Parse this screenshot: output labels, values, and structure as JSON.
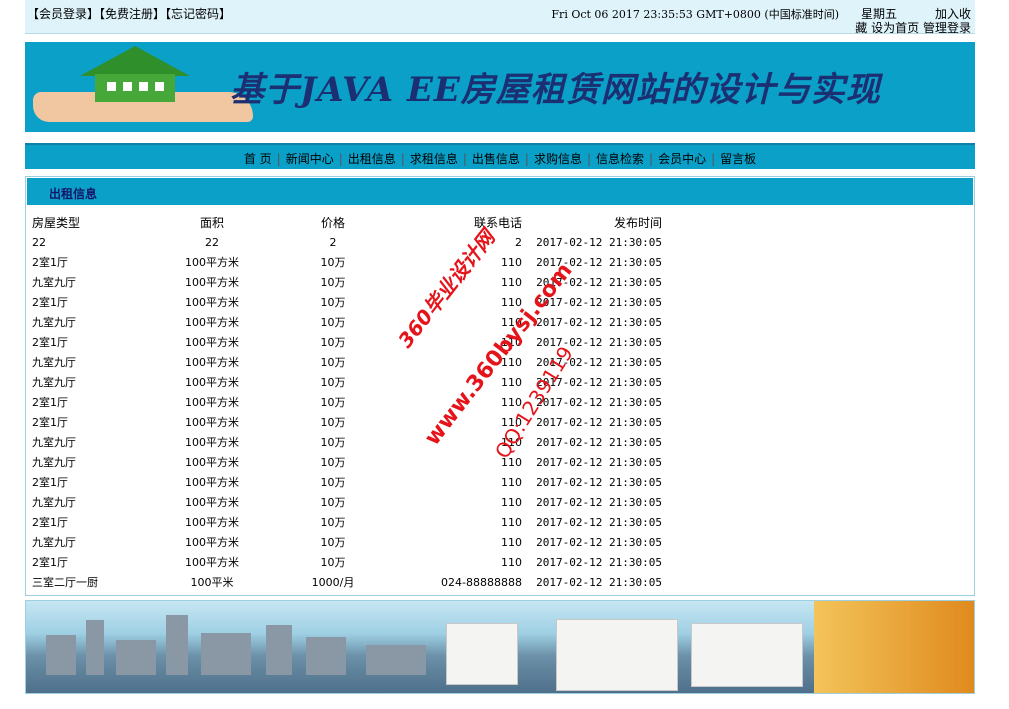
{
  "topbar": {
    "member_login": "【会员登录】",
    "register": "【免费注册】",
    "forgot_password": "【忘记密码】",
    "clock": "Fri Oct 06 2017 23:35:53 GMT+0800 (中国标准时间)",
    "weekday": "星期五",
    "add_favorite_1": "加入收",
    "add_favorite_2": "藏",
    "set_homepage": "设为首页",
    "admin_login": "管理登录"
  },
  "banner": {
    "title": "基于JAVA EE房屋租赁网站的设计与实现"
  },
  "nav": {
    "items": [
      "首 页",
      "新闻中心",
      "出租信息",
      "求租信息",
      "出售信息",
      "求购信息",
      "信息检索",
      "会员中心",
      "留言板"
    ]
  },
  "panel": {
    "title": "出租信息",
    "columns": [
      "房屋类型",
      "面积",
      "价格",
      "联系电话",
      "发布时间"
    ],
    "rows": [
      [
        "22",
        "22",
        "2",
        "2",
        "2017-02-12 21:30:05"
      ],
      [
        "2室1厅",
        "100平方米",
        "10万",
        "110",
        "2017-02-12 21:30:05"
      ],
      [
        "九室九厅",
        "100平方米",
        "10万",
        "110",
        "2017-02-12 21:30:05"
      ],
      [
        "2室1厅",
        "100平方米",
        "10万",
        "110",
        "2017-02-12 21:30:05"
      ],
      [
        "九室九厅",
        "100平方米",
        "10万",
        "110",
        "2017-02-12 21:30:05"
      ],
      [
        "2室1厅",
        "100平方米",
        "10万",
        "110",
        "2017-02-12 21:30:05"
      ],
      [
        "九室九厅",
        "100平方米",
        "10万",
        "110",
        "2017-02-12 21:30:05"
      ],
      [
        "九室九厅",
        "100平方米",
        "10万",
        "110",
        "2017-02-12 21:30:05"
      ],
      [
        "2室1厅",
        "100平方米",
        "10万",
        "110",
        "2017-02-12 21:30:05"
      ],
      [
        "2室1厅",
        "100平方米",
        "10万",
        "110",
        "2017-02-12 21:30:05"
      ],
      [
        "九室九厅",
        "100平方米",
        "10万",
        "110",
        "2017-02-12 21:30:05"
      ],
      [
        "九室九厅",
        "100平方米",
        "10万",
        "110",
        "2017-02-12 21:30:05"
      ],
      [
        "2室1厅",
        "100平方米",
        "10万",
        "110",
        "2017-02-12 21:30:05"
      ],
      [
        "九室九厅",
        "100平方米",
        "10万",
        "110",
        "2017-02-12 21:30:05"
      ],
      [
        "2室1厅",
        "100平方米",
        "10万",
        "110",
        "2017-02-12 21:30:05"
      ],
      [
        "九室九厅",
        "100平方米",
        "10万",
        "110",
        "2017-02-12 21:30:05"
      ],
      [
        "2室1厅",
        "100平方米",
        "10万",
        "110",
        "2017-02-12 21:30:05"
      ],
      [
        "三室二厅一厨",
        "100平米",
        "1000/月",
        "024-88888888",
        "2017-02-12 21:30:05"
      ]
    ]
  },
  "watermark": {
    "line1": "360毕业设计网",
    "line2": "www.360bysj.com",
    "line3": "QQ:1239119"
  },
  "colors": {
    "accent": "#0aa0c8",
    "topbar_bg": "#dff3fb",
    "panel_title": "#15166a",
    "watermark": "#e5141b"
  }
}
